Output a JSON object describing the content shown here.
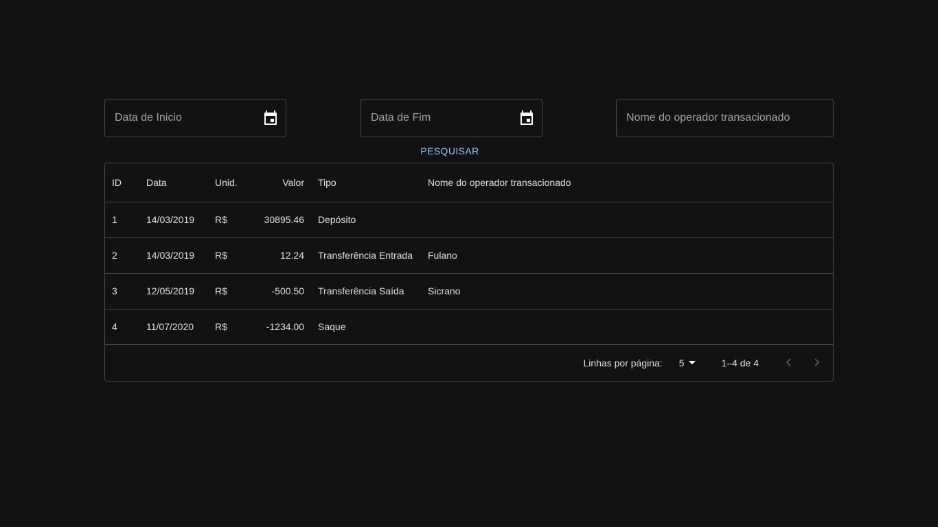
{
  "filters": {
    "start_date_placeholder": "Data de Inicio",
    "end_date_placeholder": "Data de Fim",
    "operator_placeholder": "Nome do operador transacionado",
    "start_date_icon": "calendar-icon",
    "end_date_icon": "calendar-icon"
  },
  "search_button": "PESQUISAR",
  "colors": {
    "background": "#121212",
    "accent": "#90caf9",
    "border": "rgba(255,255,255,0.23)"
  },
  "table": {
    "headers": [
      "ID",
      "Data",
      "Unid.",
      "Valor",
      "Tipo",
      "Nome do operador transacionado"
    ],
    "rows": [
      {
        "id": "1",
        "date": "14/03/2019",
        "unit": "R$",
        "value": "30895.46",
        "type": "Depósito",
        "operator": ""
      },
      {
        "id": "2",
        "date": "14/03/2019",
        "unit": "R$",
        "value": "12.24",
        "type": "Transferência Entrada",
        "operator": "Fulano"
      },
      {
        "id": "3",
        "date": "12/05/2019",
        "unit": "R$",
        "value": "-500.50",
        "type": "Transferência Saída",
        "operator": "Sicrano"
      },
      {
        "id": "4",
        "date": "11/07/2020",
        "unit": "R$",
        "value": "-1234.00",
        "type": "Saque",
        "operator": ""
      }
    ]
  },
  "pagination": {
    "rows_per_page_label": "Linhas por página:",
    "rows_per_page_value": "5",
    "range_label": "1–4 de 4",
    "prev_icon": "chevron-left-icon",
    "next_icon": "chevron-right-icon"
  }
}
